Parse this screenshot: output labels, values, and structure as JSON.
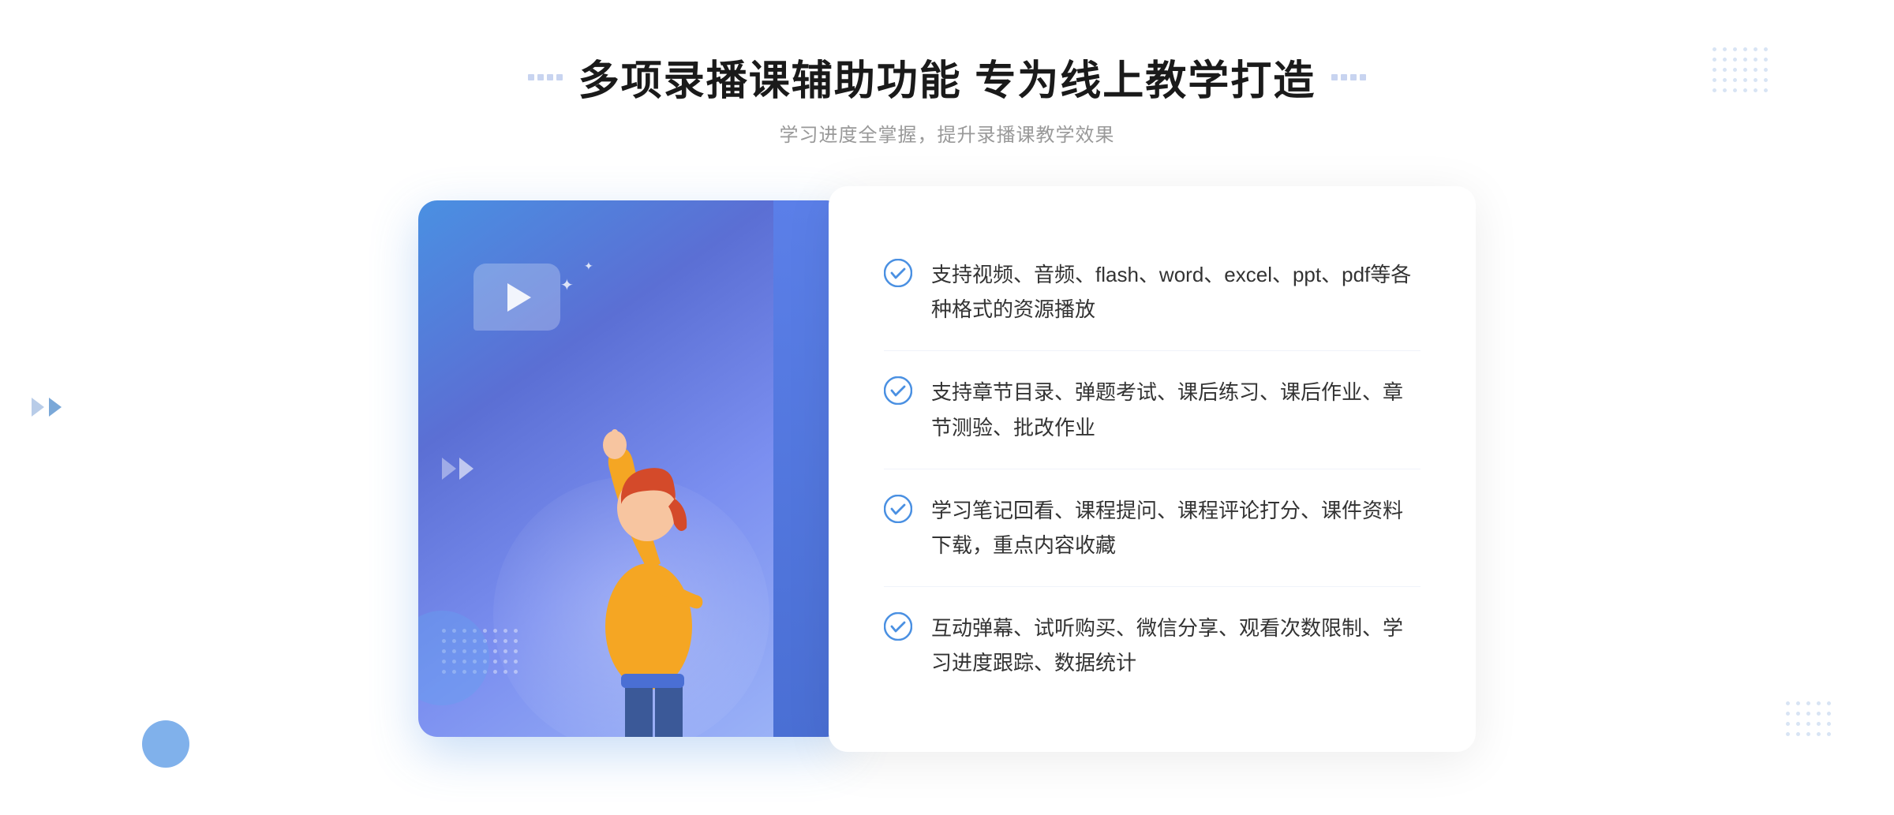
{
  "header": {
    "title": "多项录播课辅助功能 专为线上教学打造",
    "subtitle": "学习进度全掌握，提升录播课教学效果"
  },
  "features": [
    {
      "id": 1,
      "text": "支持视频、音频、flash、word、excel、ppt、pdf等各种格式的资源播放"
    },
    {
      "id": 2,
      "text": "支持章节目录、弹题考试、课后练习、课后作业、章节测验、批改作业"
    },
    {
      "id": 3,
      "text": "学习笔记回看、课程提问、课程评论打分、课件资料下载，重点内容收藏"
    },
    {
      "id": 4,
      "text": "互动弹幕、试听购买、微信分享、观看次数限制、学习进度跟踪、数据统计"
    }
  ],
  "icons": {
    "check": "✓",
    "play": "▶",
    "chevron": "»",
    "sparkle": "✦"
  },
  "colors": {
    "primary": "#4a90e2",
    "secondary": "#5b6fd4",
    "accent": "#7b8ff0",
    "text_dark": "#1a1a1a",
    "text_grey": "#999999",
    "feature_text": "#333333",
    "border": "#f0f3fa",
    "dot_bg": "#d0d8f0"
  }
}
